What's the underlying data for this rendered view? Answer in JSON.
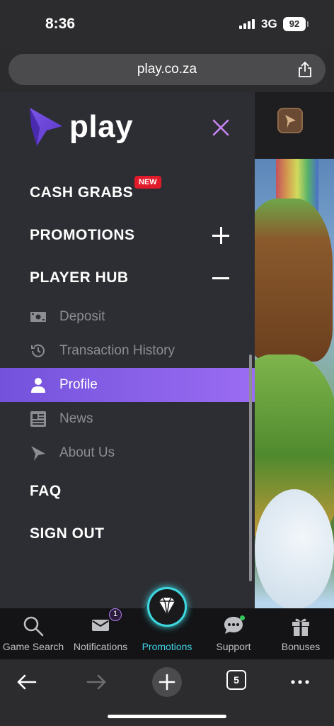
{
  "status_bar": {
    "time": "8:36",
    "network": "3G",
    "battery": "92"
  },
  "browser": {
    "url": "play.co.za",
    "tabs_count": "5"
  },
  "brand": {
    "name": "play"
  },
  "menu": {
    "cash_grabs": "CASH GRABS",
    "new_badge": "NEW",
    "promotions": "PROMOTIONS",
    "player_hub": "PLAYER HUB",
    "sub_items": [
      {
        "label": "Deposit",
        "icon": "cash-icon"
      },
      {
        "label": "Transaction History",
        "icon": "history-icon"
      },
      {
        "label": "Profile",
        "icon": "user-icon",
        "active": true
      },
      {
        "label": "News",
        "icon": "news-icon"
      },
      {
        "label": "About Us",
        "icon": "play-logo-icon"
      }
    ],
    "faq": "FAQ",
    "sign_out": "SIGN OUT"
  },
  "bottom_nav": {
    "items": [
      {
        "label": "Game Search",
        "icon": "search-icon"
      },
      {
        "label": "Notifications",
        "icon": "mail-icon",
        "badge": "1"
      },
      {
        "label": "Promotions",
        "icon": "diamond-icon"
      },
      {
        "label": "Support",
        "icon": "chat-icon"
      },
      {
        "label": "Bonuses",
        "icon": "gift-icon"
      }
    ]
  },
  "colors": {
    "accent": "#8a5ff0",
    "promo": "#3dd8e0",
    "badge": "#e11b2a"
  }
}
